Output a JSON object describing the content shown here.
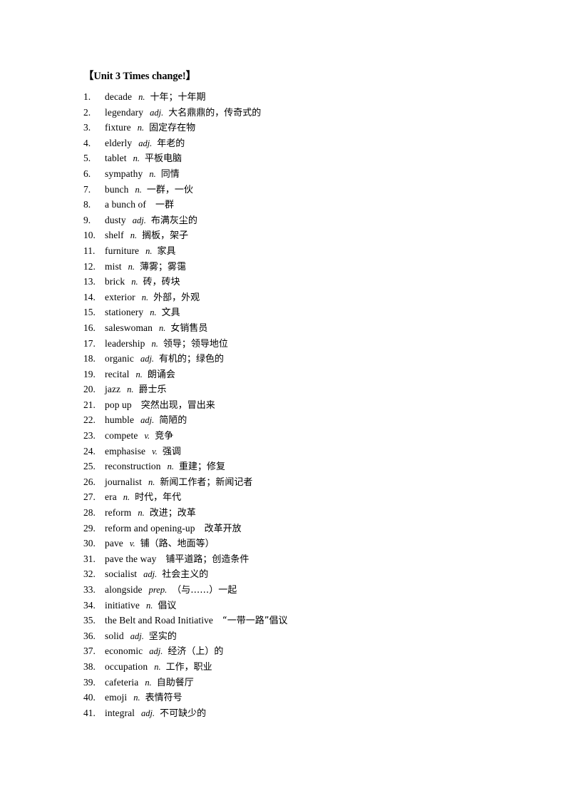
{
  "document": {
    "title": "【Unit 3 Times change!】",
    "vocabulary": [
      {
        "num": "1.",
        "word": "decade",
        "pos": "n.",
        "definition": "十年；十年期"
      },
      {
        "num": "2.",
        "word": "legendary",
        "pos": "adj.",
        "definition": "大名鼎鼎的，传奇式的"
      },
      {
        "num": "3.",
        "word": "fixture",
        "pos": "n.",
        "definition": "固定存在物"
      },
      {
        "num": "4.",
        "word": "elderly",
        "pos": "adj.",
        "definition": "年老的"
      },
      {
        "num": "5.",
        "word": "tablet",
        "pos": "n.",
        "definition": "平板电脑"
      },
      {
        "num": "6.",
        "word": "sympathy",
        "pos": "n.",
        "definition": "同情"
      },
      {
        "num": "7.",
        "word": "bunch",
        "pos": "n.",
        "definition": "一群，一伙"
      },
      {
        "num": "8.",
        "word": "a bunch of",
        "pos": "",
        "definition": "一群"
      },
      {
        "num": "9.",
        "word": "dusty",
        "pos": "adj.",
        "definition": "布满灰尘的"
      },
      {
        "num": "10.",
        "word": "shelf",
        "pos": "n.",
        "definition": "搁板，架子"
      },
      {
        "num": "11.",
        "word": "furniture",
        "pos": "n.",
        "definition": "家具"
      },
      {
        "num": "12.",
        "word": "mist",
        "pos": "n.",
        "definition": "薄雾；雾霭"
      },
      {
        "num": "13.",
        "word": "brick",
        "pos": "n.",
        "definition": "砖，砖块"
      },
      {
        "num": "14.",
        "word": "exterior",
        "pos": "n.",
        "definition": "外部，外观"
      },
      {
        "num": "15.",
        "word": "stationery",
        "pos": "n.",
        "definition": "文具"
      },
      {
        "num": "16.",
        "word": "saleswoman",
        "pos": "n.",
        "definition": "女销售员"
      },
      {
        "num": "17.",
        "word": "leadership",
        "pos": "n.",
        "definition": "领导；领导地位"
      },
      {
        "num": "18.",
        "word": "organic",
        "pos": "adj.",
        "definition": "有机的；绿色的"
      },
      {
        "num": "19.",
        "word": "recital",
        "pos": "n.",
        "definition": "朗诵会"
      },
      {
        "num": "20.",
        "word": "jazz",
        "pos": "n.",
        "definition": "爵士乐"
      },
      {
        "num": "21.",
        "word": "pop up",
        "pos": "",
        "definition": "突然出现，冒出来"
      },
      {
        "num": "22.",
        "word": "humble",
        "pos": "adj.",
        "definition": "简陋的"
      },
      {
        "num": "23.",
        "word": "compete",
        "pos": "v.",
        "definition": "竞争"
      },
      {
        "num": "24.",
        "word": "emphasise",
        "pos": "v.",
        "definition": "强调"
      },
      {
        "num": "25.",
        "word": "reconstruction",
        "pos": "n.",
        "definition": "重建；修复"
      },
      {
        "num": "26.",
        "word": "journalist",
        "pos": "n.",
        "definition": "新闻工作者；新闻记者"
      },
      {
        "num": "27.",
        "word": "era",
        "pos": "n.",
        "definition": "时代，年代"
      },
      {
        "num": "28.",
        "word": "reform",
        "pos": "n.",
        "definition": "改进；改革"
      },
      {
        "num": "29.",
        "word": "reform and opening-up",
        "pos": "",
        "definition": "改革开放"
      },
      {
        "num": "30.",
        "word": "pave",
        "pos": "v.",
        "definition": "铺（路、地面等）"
      },
      {
        "num": "31.",
        "word": "pave the way",
        "pos": "",
        "definition": "铺平道路；创造条件"
      },
      {
        "num": "32.",
        "word": "socialist",
        "pos": "adj.",
        "definition": "社会主义的"
      },
      {
        "num": "33.",
        "word": "alongside",
        "pos": "prep.",
        "definition": "（与……）一起"
      },
      {
        "num": "34.",
        "word": "initiative",
        "pos": "n.",
        "definition": "倡议"
      },
      {
        "num": "35.",
        "word": "the Belt and Road Initiative",
        "pos": "",
        "definition": "“一带一路”倡议"
      },
      {
        "num": "36.",
        "word": "solid",
        "pos": "adj.",
        "definition": "坚实的"
      },
      {
        "num": "37.",
        "word": "economic",
        "pos": "adj.",
        "definition": "经济（上）的"
      },
      {
        "num": "38.",
        "word": "occupation",
        "pos": "n.",
        "definition": "工作，职业"
      },
      {
        "num": "39.",
        "word": "cafeteria",
        "pos": "n.",
        "definition": "自助餐厅"
      },
      {
        "num": "40.",
        "word": "emoji",
        "pos": "n.",
        "definition": "表情符号"
      },
      {
        "num": "41.",
        "word": "integral",
        "pos": "adj.",
        "definition": "不可缺少的"
      }
    ]
  }
}
